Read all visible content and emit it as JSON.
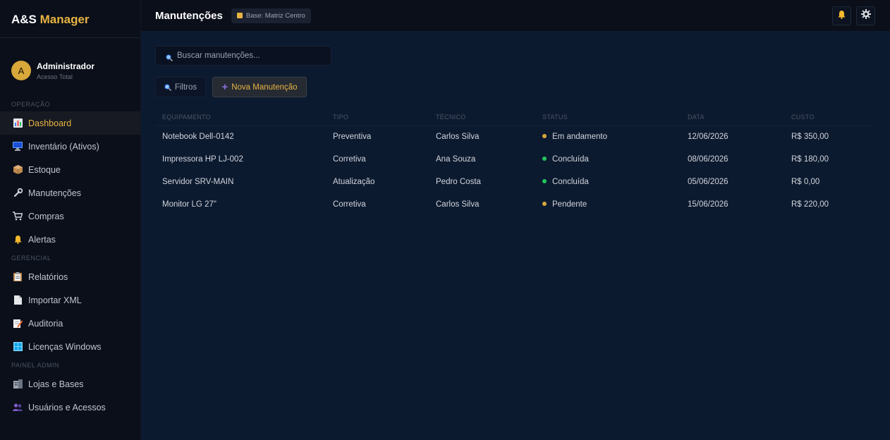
{
  "brand": {
    "part1": "A&S",
    "part2": "Manager"
  },
  "user": {
    "initial": "A",
    "name": "Administrador",
    "role": "Acesso Total"
  },
  "sidebar": {
    "sections": [
      {
        "title": "OPERAÇÃO",
        "items": [
          {
            "label": "Dashboard",
            "icon": "chart-icon",
            "active": true
          },
          {
            "label": "Inventário (Ativos)",
            "icon": "monitor-icon"
          },
          {
            "label": "Estoque",
            "icon": "box-icon"
          },
          {
            "label": "Manutenções",
            "icon": "wrench-icon"
          },
          {
            "label": "Compras",
            "icon": "cart-icon"
          },
          {
            "label": "Alertas",
            "icon": "bell-icon"
          }
        ]
      },
      {
        "title": "GERENCIAL",
        "items": [
          {
            "label": "Relatórios",
            "icon": "clipboard-icon"
          },
          {
            "label": "Importar XML",
            "icon": "document-icon"
          },
          {
            "label": "Auditoria",
            "icon": "memo-icon"
          },
          {
            "label": "Licenças Windows",
            "icon": "windows-icon"
          }
        ]
      },
      {
        "title": "PAINEL ADMIN",
        "items": [
          {
            "label": "Lojas e Bases",
            "icon": "building-icon"
          },
          {
            "label": "Usuários e Acessos",
            "icon": "users-icon"
          }
        ]
      }
    ]
  },
  "header": {
    "title": "Manutenções",
    "base_badge": "Base: Matriz Centro"
  },
  "search": {
    "placeholder": "Buscar manutenções..."
  },
  "toolbar": {
    "filter_label": "Filtros",
    "new_label": "Nova Manutenção"
  },
  "table": {
    "columns": [
      "EQUIPAMENTO",
      "TIPO",
      "TÉCNICO",
      "STATUS",
      "DATA",
      "CUSTO"
    ],
    "rows": [
      [
        "Notebook Dell-0142",
        "Preventiva",
        "Carlos Silva",
        "Em andamento",
        "12/06/2026",
        "R$ 350,00"
      ],
      [
        "Impressora HP LJ-002",
        "Corretiva",
        "Ana Souza",
        "Concluída",
        "08/06/2026",
        "R$ 180,00"
      ],
      [
        "Servidor SRV-MAIN",
        "Atualização",
        "Pedro Costa",
        "Concluída",
        "05/06/2026",
        "R$ 0,00"
      ],
      [
        "Monitor LG 27\"",
        "Corretiva",
        "Carlos Silva",
        "Pendente",
        "15/06/2026",
        "R$ 220,00"
      ]
    ],
    "status_colors": {
      "Em andamento": "#d9a83a",
      "Concluída": "#22c55e",
      "Pendente": "#d9a83a"
    }
  },
  "colors": {
    "accent": "#e8b341",
    "background": "#0c1a30",
    "sidebar": "#0a0f1a"
  }
}
